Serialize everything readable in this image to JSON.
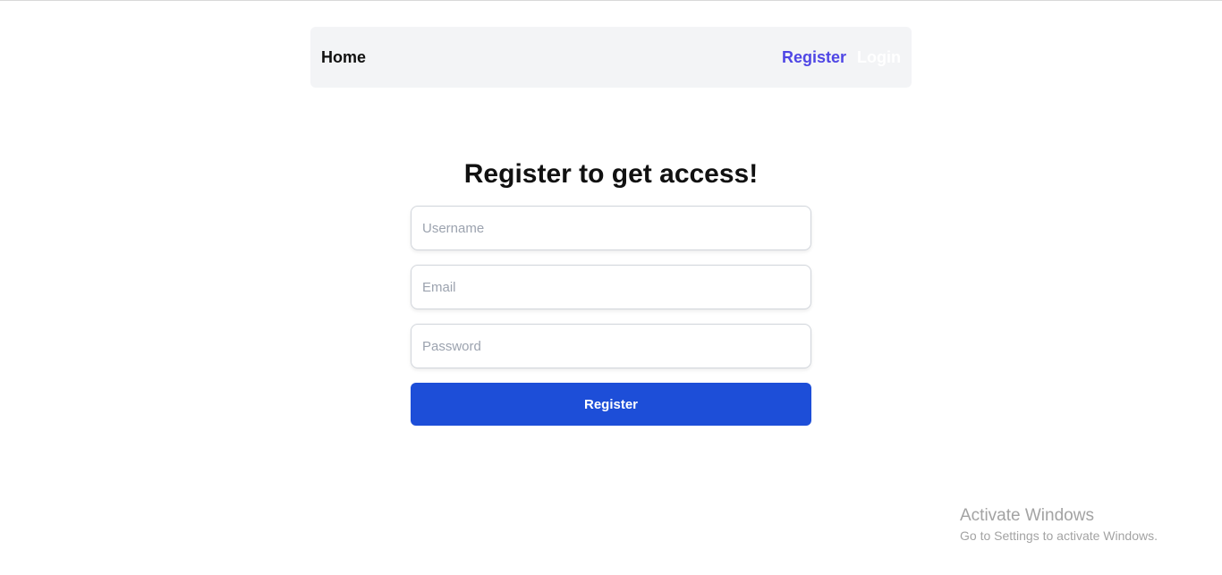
{
  "nav": {
    "home_label": "Home",
    "register_label": "Register",
    "login_label": "Login"
  },
  "page": {
    "title": "Register to get access!"
  },
  "form": {
    "username_placeholder": "Username",
    "username_value": "",
    "email_placeholder": "Email",
    "email_value": "",
    "password_placeholder": "Password",
    "password_value": "",
    "submit_label": "Register"
  },
  "watermark": {
    "title": "Activate Windows",
    "subtitle": "Go to Settings to activate Windows."
  },
  "colors": {
    "nav_background": "#f3f4f6",
    "register_link": "#4f46e5",
    "login_link": "#ffffff",
    "submit_button": "#1d4ed8"
  }
}
